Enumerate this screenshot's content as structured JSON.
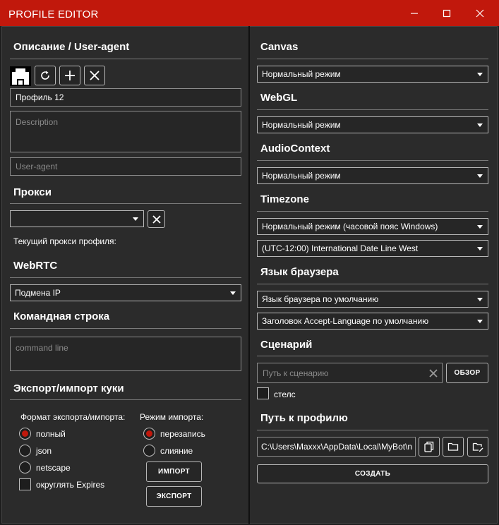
{
  "window": {
    "title": "PROFILE EDITOR"
  },
  "sections": {
    "description": "Описание / User-agent",
    "proxy": "Прокси",
    "webrtc": "WebRTC",
    "cmdline": "Командная строка",
    "cookies": "Экспорт/импорт куки",
    "canvas": "Canvas",
    "webgl": "WebGL",
    "audio": "AudioContext",
    "timezone": "Timezone",
    "lang": "Язык браузера",
    "script": "Сценарий",
    "path": "Путь к профилю"
  },
  "profile": {
    "name": "Профиль 12",
    "description_placeholder": "Description",
    "useragent_placeholder": "User-agent"
  },
  "proxy": {
    "selected": "",
    "current_label": "Текущий прокси профиля:"
  },
  "webrtc": {
    "selected": "Подмена IP"
  },
  "cmdline": {
    "placeholder": "command line"
  },
  "cookies": {
    "format_label": "Формат экспорта/импорта:",
    "formats": [
      "полный",
      "json",
      "netscape"
    ],
    "format_selected": 0,
    "round_expires": "округлять Expires",
    "mode_label": "Режим импорта:",
    "modes": [
      "перезапись",
      "слияние"
    ],
    "mode_selected": 0,
    "import": "ИМПОРТ",
    "export": "ЭКСПОРТ"
  },
  "canvas": {
    "selected": "Нормальный режим"
  },
  "webgl": {
    "selected": "Нормальный режим"
  },
  "audio": {
    "selected": "Нормальный режим"
  },
  "timezone": {
    "mode": "Нормальный режим (часовой пояс Windows)",
    "zone": "(UTC-12:00) International Date Line West"
  },
  "lang": {
    "browser": "Язык браузера по умолчанию",
    "accept": "Заголовок Accept-Language по умолчанию"
  },
  "script": {
    "placeholder": "Путь к сценарию",
    "browse": "ОБЗОР",
    "stealth": "стелс"
  },
  "path": {
    "value": "C:\\Users\\Maxxx\\AppData\\Local\\MyBot\\n",
    "create": "СОЗДАТЬ"
  },
  "colors": {
    "accent": "#c1180c",
    "background": "#2b2b2b"
  }
}
